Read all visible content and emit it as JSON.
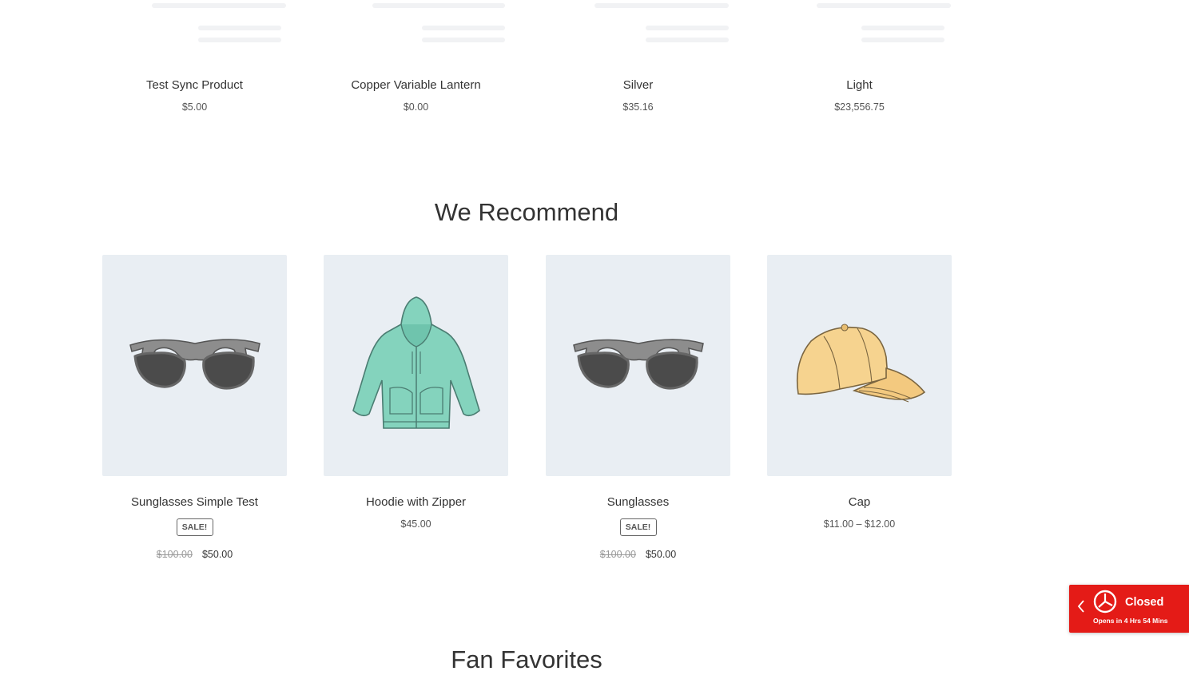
{
  "top_products": [
    {
      "name": "Test Sync Product",
      "price": "$5.00"
    },
    {
      "name": "Copper Variable Lantern",
      "price": "$0.00"
    },
    {
      "name": "Silver",
      "price": "$35.16"
    },
    {
      "name": "Light",
      "price": "$23,556.75"
    }
  ],
  "recommend": {
    "title": "We Recommend",
    "products": [
      {
        "name": "Sunglasses Simple Test",
        "badge": "SALE!",
        "old_price": "$100.00",
        "price": "$50.00",
        "image_icon": "sunglasses-icon"
      },
      {
        "name": "Hoodie with Zipper",
        "price": "$45.00",
        "image_icon": "hoodie-icon"
      },
      {
        "name": "Sunglasses",
        "badge": "SALE!",
        "old_price": "$100.00",
        "price": "$50.00",
        "image_icon": "sunglasses-icon"
      },
      {
        "name": "Cap",
        "price": "$11.00 – $12.00",
        "image_icon": "cap-icon"
      }
    ]
  },
  "fan_favorites": {
    "title": "Fan Favorites"
  },
  "store_status": {
    "status": "Closed",
    "subtitle": "Opens in 4 Hrs 54 Mins",
    "color": "#e41b17"
  }
}
